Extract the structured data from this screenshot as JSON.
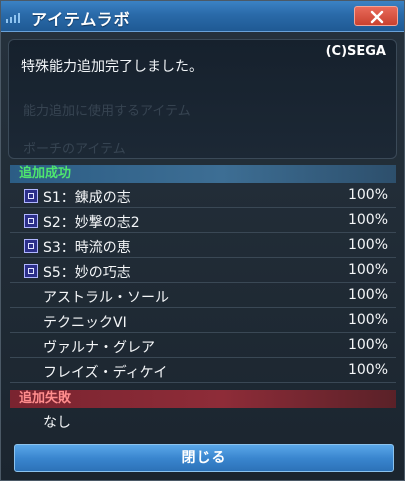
{
  "window": {
    "title": "アイテムラボ"
  },
  "message": {
    "text": "特殊能力追加完了しました。",
    "copyright": "(C)SEGA",
    "ghost_lines": [
      "能力追加に使用するアイテム",
      "ポーチのアイテム"
    ]
  },
  "success_section": {
    "label": "追加成功",
    "items": [
      {
        "name": "S1：錬成の志",
        "rate": "100%",
        "has_icon": true
      },
      {
        "name": "S2：妙撃の志2",
        "rate": "100%",
        "has_icon": true
      },
      {
        "name": "S3：時流の恵",
        "rate": "100%",
        "has_icon": true
      },
      {
        "name": "S5：妙の巧志",
        "rate": "100%",
        "has_icon": true
      },
      {
        "name": "アストラル・ソール",
        "rate": "100%",
        "has_icon": false
      },
      {
        "name": "テクニックVI",
        "rate": "100%",
        "has_icon": false
      },
      {
        "name": "ヴァルナ・グレア",
        "rate": "100%",
        "has_icon": false
      },
      {
        "name": "フレイズ・ディケイ",
        "rate": "100%",
        "has_icon": false
      }
    ]
  },
  "fail_section": {
    "label": "追加失敗",
    "items": [
      {
        "name": "なし"
      }
    ]
  },
  "buttons": {
    "close_label": "閉じる"
  },
  "colors": {
    "title_bar": "#2a6aa9",
    "success_text": "#4ee66f",
    "fail_text": "#ff8d8d",
    "close_button": "#c9412f",
    "primary_button": "#3a86cf"
  }
}
